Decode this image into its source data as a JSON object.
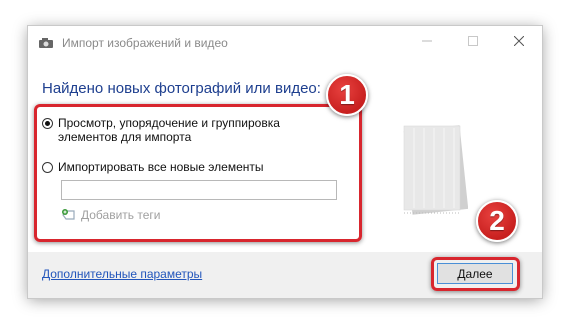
{
  "window": {
    "title": "Импорт изображений и видео",
    "controls": {
      "minimize_icon": "minimize-icon",
      "maximize_icon": "maximize-icon",
      "close_icon": "close-icon"
    }
  },
  "content": {
    "heading": "Найдено новых фотографий или видео:",
    "options": [
      {
        "label": "Просмотр, упорядочение и группировка элементов для импорта",
        "selected": true
      },
      {
        "label": "Импортировать все новые элементы",
        "selected": false
      }
    ],
    "tags_input_value": "",
    "add_tags_label": "Добавить теги"
  },
  "footer": {
    "more_params_link": "Дополнительные параметры",
    "next_button": "Далее"
  },
  "annotations": {
    "badge_1": "1",
    "badge_2": "2",
    "highlight_color": "#d8262e"
  },
  "colors": {
    "heading": "#1e3f8f",
    "link": "#2255bb",
    "button_border": "#4a8fd6"
  }
}
